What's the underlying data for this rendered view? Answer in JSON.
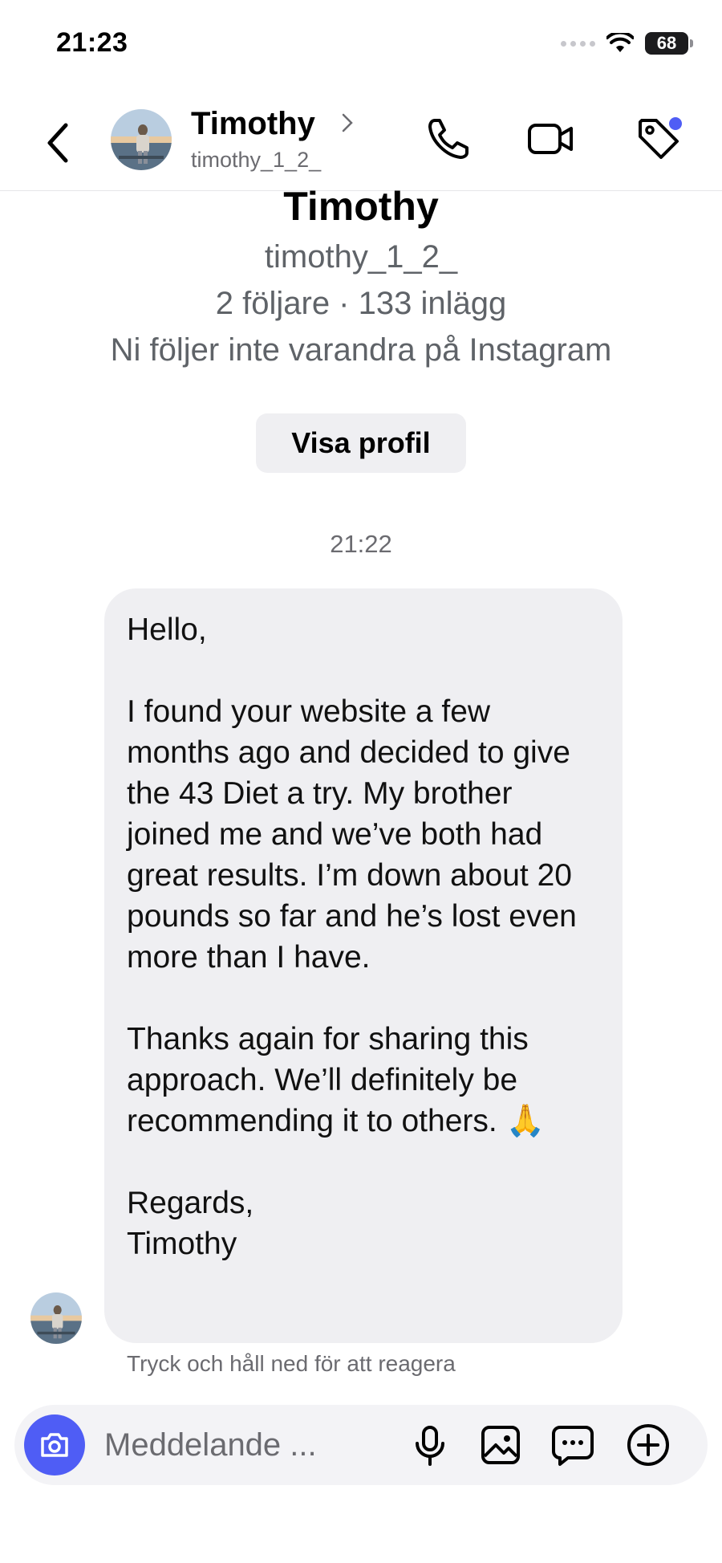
{
  "status_bar": {
    "time": "21:23",
    "battery": "68"
  },
  "header": {
    "name": "Timothy",
    "handle": "timothy_1_2_"
  },
  "profile": {
    "name": "Timothy",
    "handle": "timothy_1_2_",
    "stats": "2 följare · 133 inlägg",
    "relationship": "Ni följer inte varandra på Instagram",
    "view_profile_label": "Visa profil"
  },
  "conversation": {
    "timestamp": "21:22",
    "message": {
      "greeting": "Hello,",
      "para1": "I found your website a few months ago and decided to give the 43 Diet a try. My brother joined me and we’ve both had great results. I’m down about 20 pounds so far and he’s lost even more than I have.",
      "para2": "Thanks again for sharing this approach. We’ll definitely be recommending it to others. 🙏",
      "signoff": "Regards,",
      "signature": "Timothy"
    },
    "react_hint": "Tryck och håll ned för att reagera"
  },
  "composer": {
    "placeholder": "Meddelande ..."
  },
  "colors": {
    "accent": "#4f5df5",
    "bubble": "#efeff2",
    "secondary_text": "#5f6368"
  }
}
